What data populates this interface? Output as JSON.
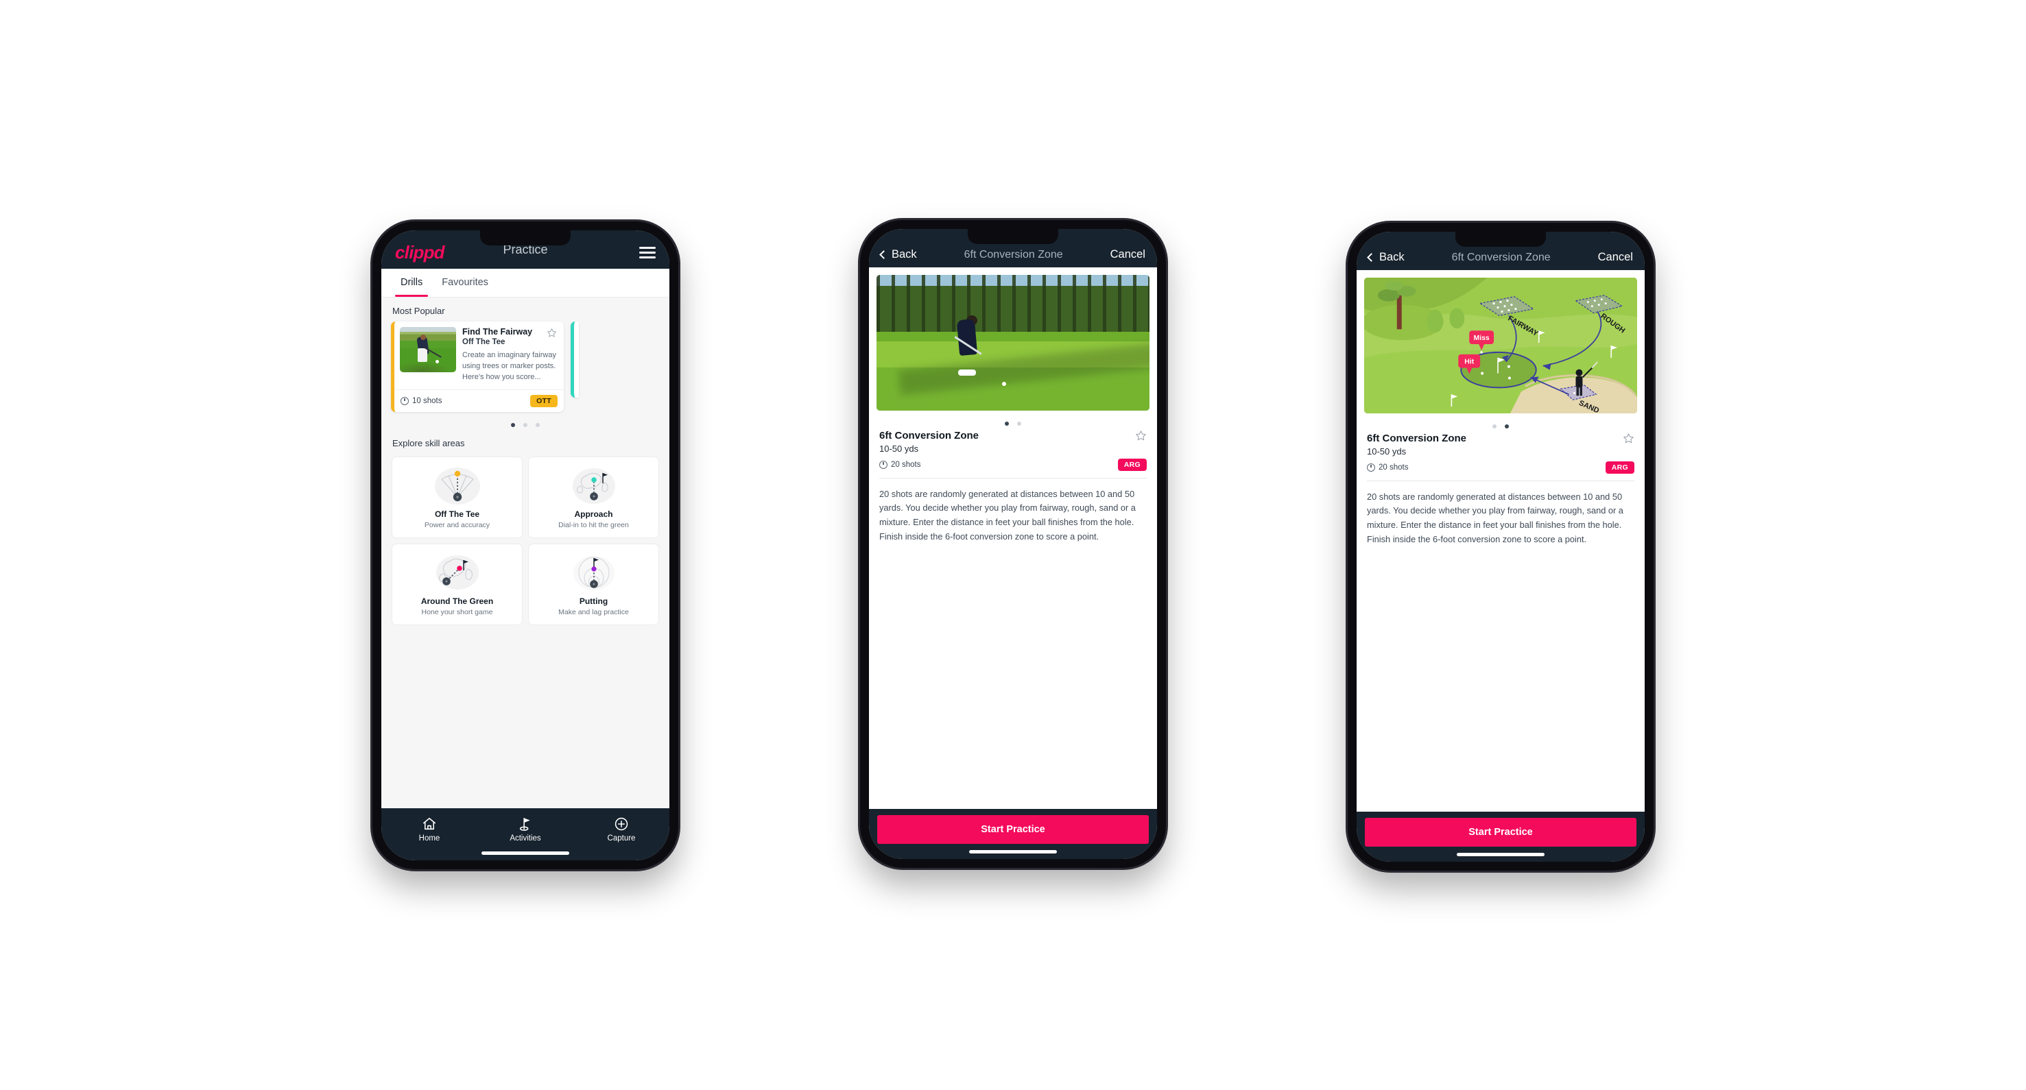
{
  "accent": {
    "pink": "#f40b5c",
    "navy": "#17232e",
    "yellow": "#f6b71d",
    "teal": "#2fd6bd"
  },
  "phone1": {
    "brand": "clippd",
    "header_title": "Practice",
    "menu_icon": "hamburger-menu-icon",
    "tabs": [
      {
        "label": "Drills",
        "active": true
      },
      {
        "label": "Favourites",
        "active": false
      }
    ],
    "most_popular_label": "Most Popular",
    "drill_card": {
      "title": "Find The Fairway",
      "subtitle": "Off The Tee",
      "description": "Create an imaginary fairway using trees or marker posts. Here's how you score...",
      "shots": "10 shots",
      "badge": "OTT",
      "star_icon": "star-outline-icon",
      "clock_icon": "clock-icon",
      "accent_bar": "#f5b420"
    },
    "carousel_dots": [
      true,
      false,
      false
    ],
    "explore_label": "Explore skill areas",
    "skills": [
      {
        "name": "Off The Tee",
        "desc": "Power and accuracy",
        "icon": "off-the-tee-icon",
        "dot_color": "#f5b420"
      },
      {
        "name": "Approach",
        "desc": "Dial-in to hit the green",
        "icon": "approach-icon",
        "dot_color": "#2fd6bd"
      },
      {
        "name": "Around The Green",
        "desc": "Hone your short game",
        "icon": "around-the-green-icon",
        "dot_color": "#f40b5c"
      },
      {
        "name": "Putting",
        "desc": "Make and lag practice",
        "icon": "putting-icon",
        "dot_color": "#9b1fd6"
      }
    ],
    "bottom_nav": [
      {
        "label": "Home",
        "icon": "home-icon"
      },
      {
        "label": "Activities",
        "icon": "golf-flag-icon"
      },
      {
        "label": "Capture",
        "icon": "plus-circle-icon"
      }
    ]
  },
  "phone2": {
    "nav": {
      "back": "Back",
      "title": "6ft Conversion Zone",
      "cancel": "Cancel",
      "back_icon": "chevron-left-icon"
    },
    "media_type": "photo",
    "media_alt": "golfer-chipping-photo",
    "carousel_dots": [
      true,
      false
    ],
    "title": "6ft Conversion Zone",
    "distance": "10-50 yds",
    "shots": "20 shots",
    "badge": "ARG",
    "star_icon": "star-outline-icon",
    "clock_icon": "clock-icon",
    "description": "20 shots are randomly generated at distances between 10 and 50 yards. You decide whether you play from fairway, rough, sand or a mixture. Enter the distance in feet your ball finishes from the hole. Finish inside the 6-foot conversion zone to score a point.",
    "cta": "Start Practice"
  },
  "phone3": {
    "nav": {
      "back": "Back",
      "title": "6ft Conversion Zone",
      "cancel": "Cancel",
      "back_icon": "chevron-left-icon"
    },
    "media_type": "illustration",
    "media_alt": "course-zones-diagram",
    "illustration_labels": {
      "fairway": "FAIRWAY",
      "rough": "ROUGH",
      "sand": "SAND",
      "miss": "Miss",
      "hit": "Hit"
    },
    "carousel_dots": [
      false,
      true
    ],
    "title": "6ft Conversion Zone",
    "distance": "10-50 yds",
    "shots": "20 shots",
    "badge": "ARG",
    "star_icon": "star-outline-icon",
    "clock_icon": "clock-icon",
    "description": "20 shots are randomly generated at distances between 10 and 50 yards. You decide whether you play from fairway, rough, sand or a mixture. Enter the distance in feet your ball finishes from the hole. Finish inside the 6-foot conversion zone to score a point.",
    "cta": "Start Practice"
  }
}
